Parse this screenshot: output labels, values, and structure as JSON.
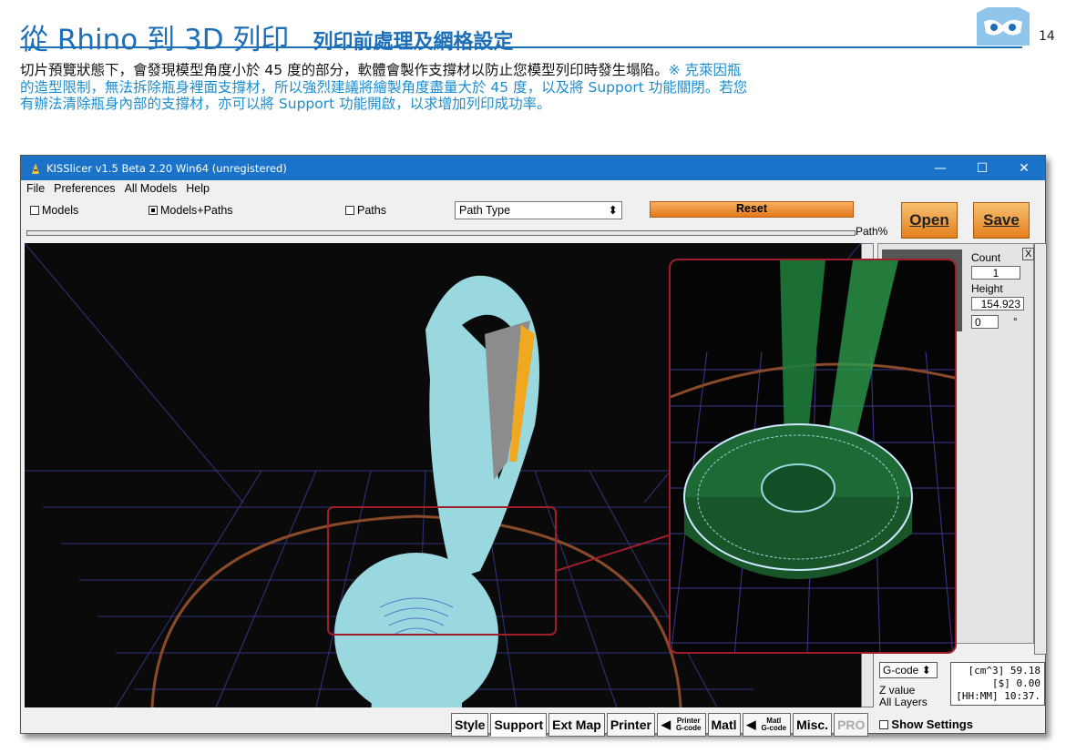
{
  "header": {
    "title": "從 Rhino 到 3D 列印",
    "subtitle": "列印前處理及網格設定",
    "page_number": "14"
  },
  "paragraph": {
    "text": "切片預覽狀態下，會發現模型角度小於 45 度的部分，軟體會製作支撐材以防止您模型列印時發生塌陷。",
    "highlight": "※ 克萊因瓶的造型限制，無法拆除瓶身裡面支撐材，所以強烈建議將繪製角度盡量大於 45 度，以及將 Support 功能關閉。若您有辦法清除瓶身內部的支撐材，亦可以將 Support 功能開啟，以求增加列印成功率。"
  },
  "window": {
    "title": "KISSlicer v1.5 Beta 2.20 Win64 (unregistered)",
    "minimize": "—",
    "maximize": "☐",
    "close": "✕"
  },
  "menu": {
    "items": [
      "File",
      "Preferences",
      "All Models",
      "Help"
    ]
  },
  "toolbar": {
    "models": "Models",
    "models_paths": "Models+Paths",
    "paths": "Paths",
    "path_type": "Path Type",
    "reset": "Reset",
    "open": "Open",
    "save": "Save",
    "path_pct": "Path%"
  },
  "side": {
    "count_label": "Count",
    "count_value": "1",
    "height_label": "Height",
    "height_value": "154.923",
    "angle_value": "0",
    "deg": "°",
    "close_x": "X"
  },
  "bottom": {
    "gcode_select": "G-code",
    "z_value": "Z value",
    "all_layers": "All Layers",
    "stat_1": "[cm^3] 59.18",
    "stat_2": "[$] 0.00",
    "stat_3": "[HH:MM] 10:37."
  },
  "tabs": {
    "style": "Style",
    "support": "Support",
    "ext_map": "Ext Map",
    "printer": "Printer",
    "printer_gcode_1": "Printer",
    "printer_gcode_2": "G-code",
    "matl": "Matl",
    "matl_gcode_1": "Matl",
    "matl_gcode_2": "G-code",
    "misc": "Misc.",
    "pro": "PRO",
    "show_settings": "Show Settings"
  },
  "colors": {
    "accent": "#1c6fb8",
    "highlight": "#1c8ed0",
    "titlebar": "#1a73c9",
    "orange": "#e4801e",
    "callout": "#a01e2c"
  }
}
